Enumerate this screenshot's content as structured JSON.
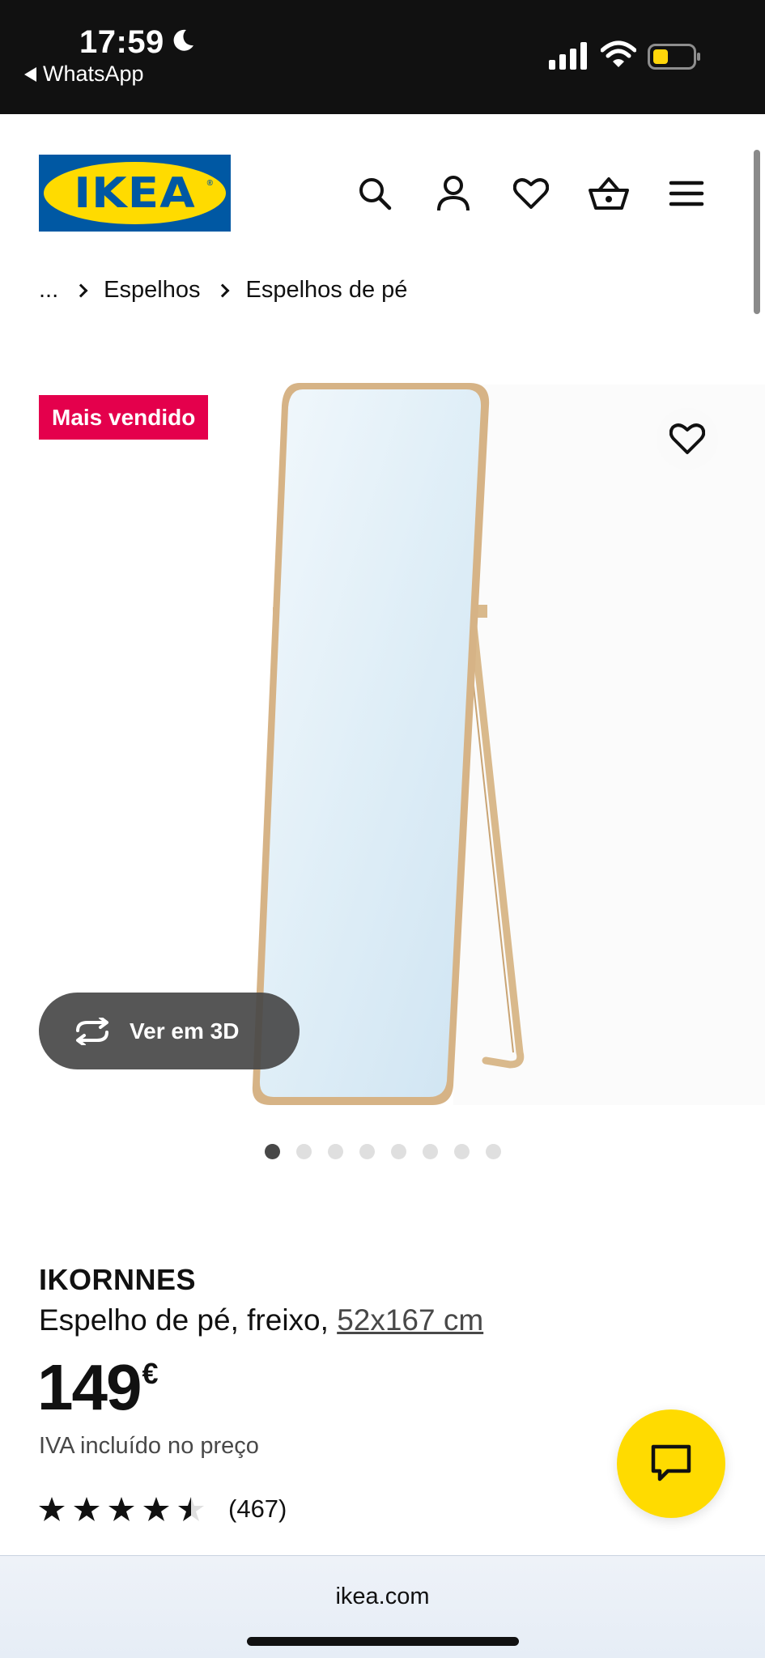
{
  "status_bar": {
    "time": "17:59",
    "back_app": "WhatsApp"
  },
  "header": {
    "logo_text": "IKEA",
    "logo_colors": {
      "blue": "#0058a3",
      "yellow": "#ffdb00"
    },
    "icons": [
      "search-icon",
      "account-icon",
      "heart-icon",
      "basket-icon",
      "menu-icon"
    ]
  },
  "breadcrumb": {
    "ellipsis": "...",
    "items": [
      "Espelhos",
      "Espelhos de pé"
    ]
  },
  "gallery": {
    "badge": "Mais vendido",
    "badge_color": "#e4004c",
    "view_3d_label": "Ver em 3D",
    "dots_total": 8,
    "active_dot": 1
  },
  "product": {
    "name": "IKORNNES",
    "description": "Espelho de pé, freixo,",
    "size": "52x167 cm",
    "price": "149",
    "currency": "€",
    "vat_note": "IVA incluído no preço",
    "rating_value": 4.5,
    "rating_count": "(467)"
  },
  "browser": {
    "url": "ikea.com"
  }
}
